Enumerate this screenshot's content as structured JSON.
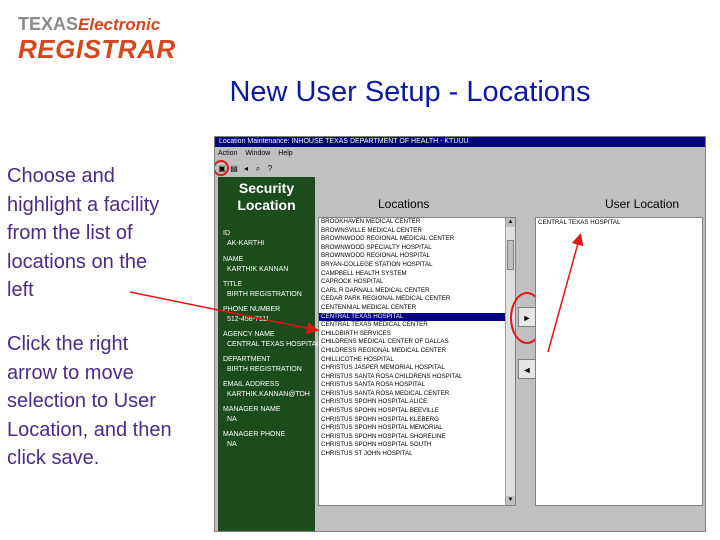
{
  "logo": {
    "line1_a": "TEXAS",
    "line1_b": "Electronic",
    "line2": "REGISTRAR"
  },
  "slide_title": "New User Setup - Locations",
  "instructions": [
    "Choose  and highlight a facility from the list of locations on the left",
    "Click the right arrow to move selection to User Location, and then click save."
  ],
  "window": {
    "title": "Location Maintenance: INHOUSE TEXAS DEPARTMENT OF HEALTH - KTUUU",
    "menu": [
      "Action",
      "Window",
      "Help"
    ],
    "toolbar_icons": [
      "save-icon",
      "print-icon",
      "back-icon",
      "find-icon",
      "help-icon"
    ],
    "security_title": "Security Location",
    "fields": [
      {
        "label": "ID",
        "value": "AK-KARTHI"
      },
      {
        "label": "NAME",
        "value": "KARTHIK KANNAN"
      },
      {
        "label": "TITLE",
        "value": "BIRTH REGISTRATION"
      },
      {
        "label": "PHONE NUMBER",
        "value": "512-458-7111"
      },
      {
        "label": "AGENCY NAME",
        "value": "CENTRAL TEXAS HOSPITAL"
      },
      {
        "label": "DEPARTMENT",
        "value": "BIRTH REGISTRATION"
      },
      {
        "label": "EMAIL ADDRESS",
        "value": "KARTHIK.KANNAN@TDH"
      },
      {
        "label": "MANAGER NAME",
        "value": "NA"
      },
      {
        "label": "MANAGER PHONE",
        "value": "NA"
      }
    ],
    "locations_header": "Locations",
    "user_location_header": "User Location",
    "locations": [
      "BROOKHAVEN MEDICAL CENTER",
      "BROWNSVILLE MEDICAL CENTER",
      "BROWNWOOD REGIONAL MEDICAL CENTER",
      "BROWNWOOD SPECIALTY HOSPITAL",
      "BROWNWOOD REGIONAL HOSPITAL",
      "BRYAN-COLLEGE STATION HOSPITAL",
      "CAMPBELL HEALTH SYSTEM",
      "CAPROCK HOSPITAL",
      "CARL R DARNALL MEDICAL CENTER",
      "CEDAR PARK REGIONAL MEDICAL CENTER",
      "CENTENNIAL MEDICAL CENTER",
      "CENTRAL TEXAS HOSPITAL",
      "CENTRAL TEXAS MEDICAL CENTER",
      "CHILDBIRTH SERVICES",
      "CHILDRENS MEDICAL CENTER OF DALLAS",
      "CHILDRESS REGIONAL MEDICAL CENTER",
      "CHILLICOTHE HOSPITAL",
      "CHRISTUS JASPER MEMORIAL HOSPITAL",
      "CHRISTUS SANTA ROSA CHILDRENS HOSPITAL",
      "CHRISTUS SANTA ROSA HOSPITAL",
      "CHRISTUS SANTA ROSA MEDICAL CENTER",
      "CHRISTUS SPOHN HOSPITAL ALICE",
      "CHRISTUS SPOHN HOSPITAL BEEVILLE",
      "CHRISTUS SPOHN HOSPITAL KLEBERG",
      "CHRISTUS SPOHN HOSPITAL MEMORIAL",
      "CHRISTUS SPOHN HOSPITAL SHORELINE",
      "CHRISTUS SPOHN HOSPITAL SOUTH",
      "CHRISTUS ST JOHN HOSPITAL"
    ],
    "selected_location_index": 11,
    "user_locations": [
      "CENTRAL TEXAS HOSPITAL"
    ]
  },
  "colors": {
    "title_blue": "#0c1aa0",
    "text_purple": "#4b2b84",
    "logo_orange": "#d4481f",
    "security_green": "#1c4b1c",
    "annotation_red": "#e31616"
  }
}
